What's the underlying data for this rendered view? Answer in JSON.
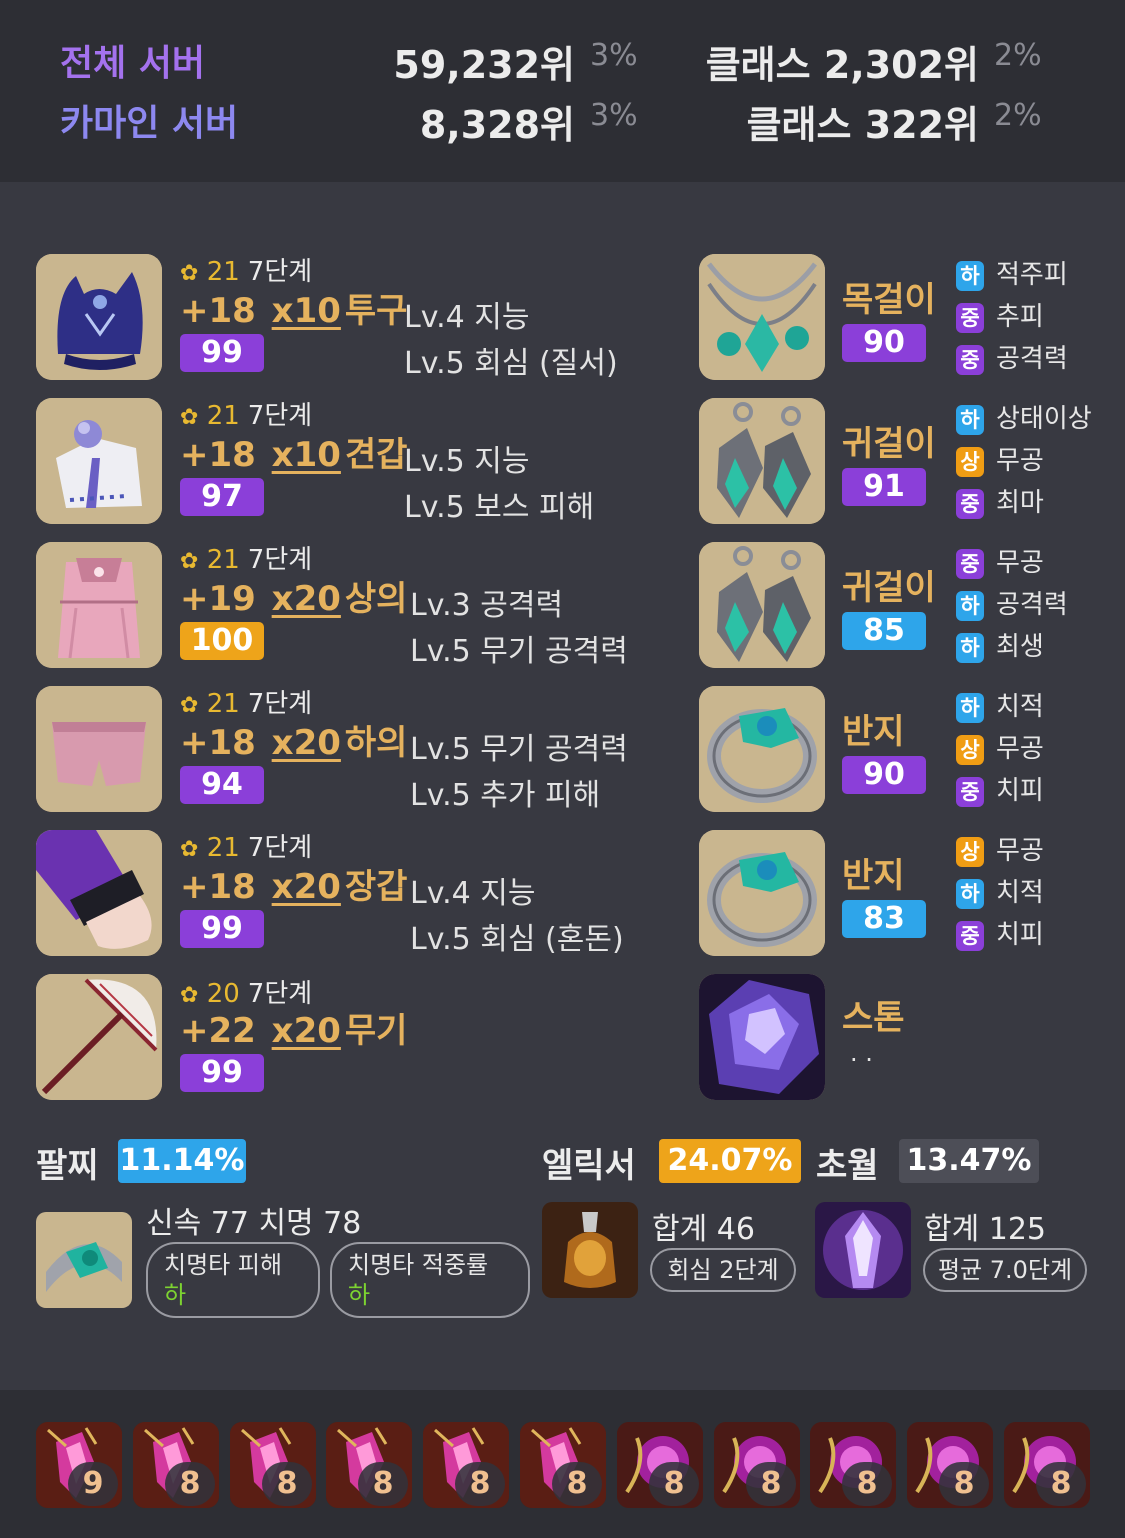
{
  "ranking": [
    {
      "name": "전체 서버",
      "color": "#a472ee",
      "rank": "59,232위",
      "rank_pct": "3%",
      "class_rank": "클래스 2,302위",
      "class_pct": "2%"
    },
    {
      "name": "카마인 서버",
      "color": "#8d88f0",
      "rank": "8,328위",
      "rank_pct": "3%",
      "class_rank": "클래스 322위",
      "class_pct": "2%"
    }
  ],
  "equipment": [
    {
      "icon": "helmet-icon",
      "tier": "21",
      "step": "7단계",
      "upgrade": "+18",
      "mult": "x10",
      "slot": "투구",
      "quality": "99",
      "quality_color": "purple",
      "engravings": [
        "Lv.4 지능",
        "Lv.5 회심 (질서)"
      ]
    },
    {
      "icon": "shoulder-icon",
      "tier": "21",
      "step": "7단계",
      "upgrade": "+18",
      "mult": "x10",
      "slot": "견갑",
      "quality": "97",
      "quality_color": "purple",
      "engravings": [
        "Lv.5 지능",
        "Lv.5 보스 피해"
      ]
    },
    {
      "icon": "chest-icon",
      "tier": "21",
      "step": "7단계",
      "upgrade": "+19",
      "mult": "x20",
      "slot": "상의",
      "quality": "100",
      "quality_color": "orange",
      "engravings": [
        "Lv.3 공격력",
        "Lv.5 무기 공격력"
      ]
    },
    {
      "icon": "pants-icon",
      "tier": "21",
      "step": "7단계",
      "upgrade": "+18",
      "mult": "x20",
      "slot": "하의",
      "quality": "94",
      "quality_color": "purple",
      "engravings": [
        "Lv.5 무기 공격력",
        "Lv.5 추가 피해"
      ]
    },
    {
      "icon": "gloves-icon",
      "tier": "21",
      "step": "7단계",
      "upgrade": "+18",
      "mult": "x20",
      "slot": "장갑",
      "quality": "99",
      "quality_color": "purple",
      "engravings": [
        "Lv.4 지능",
        "Lv.5 회심 (혼돈)"
      ]
    },
    {
      "icon": "weapon-umbrella-icon",
      "tier": "20",
      "step": "7단계",
      "upgrade": "+22",
      "mult": "x20",
      "slot": "무기",
      "quality": "99",
      "quality_color": "purple",
      "engravings": []
    }
  ],
  "accessories": [
    {
      "icon": "necklace-icon",
      "name": "목걸이",
      "quality": "90",
      "quality_color": "purple",
      "options": [
        {
          "grade": "하",
          "text": "적주피"
        },
        {
          "grade": "중",
          "text": "추피"
        },
        {
          "grade": "중",
          "text": "공격력"
        }
      ]
    },
    {
      "icon": "earring-icon",
      "name": "귀걸이",
      "quality": "91",
      "quality_color": "purple",
      "options": [
        {
          "grade": "하",
          "text": "상태이상"
        },
        {
          "grade": "상",
          "text": "무공"
        },
        {
          "grade": "중",
          "text": "최마"
        }
      ]
    },
    {
      "icon": "earring-icon",
      "name": "귀걸이",
      "quality": "85",
      "quality_color": "blue",
      "options": [
        {
          "grade": "중",
          "text": "무공"
        },
        {
          "grade": "하",
          "text": "공격력"
        },
        {
          "grade": "하",
          "text": "최생"
        }
      ]
    },
    {
      "icon": "ring-icon",
      "name": "반지",
      "quality": "90",
      "quality_color": "purple",
      "options": [
        {
          "grade": "하",
          "text": "치적"
        },
        {
          "grade": "상",
          "text": "무공"
        },
        {
          "grade": "중",
          "text": "치피"
        }
      ]
    },
    {
      "icon": "ring-icon",
      "name": "반지",
      "quality": "83",
      "quality_color": "blue",
      "options": [
        {
          "grade": "상",
          "text": "무공"
        },
        {
          "grade": "하",
          "text": "치적"
        },
        {
          "grade": "중",
          "text": "치피"
        }
      ]
    }
  ],
  "stone": {
    "icon": "ability-stone-icon",
    "name": "스톤",
    "value": "· ·"
  },
  "bracelet": {
    "label": "팔찌",
    "pct": "11.14%",
    "stats": "신속 77 치명 78",
    "tags": [
      {
        "name": "치명타 피해",
        "grade": "하"
      },
      {
        "name": "치명타 적중률",
        "grade": "하"
      }
    ]
  },
  "elixir": {
    "label": "엘릭서",
    "pct": "24.07%",
    "total": "합계 46",
    "tag": "회심 2단계"
  },
  "transcend": {
    "label": "초월",
    "pct": "13.47%",
    "total": "합계 125",
    "tag": "평균 7.0단계"
  },
  "gems": [
    {
      "type": "annihilation",
      "level": "9"
    },
    {
      "type": "annihilation",
      "level": "8"
    },
    {
      "type": "annihilation",
      "level": "8"
    },
    {
      "type": "annihilation",
      "level": "8"
    },
    {
      "type": "annihilation",
      "level": "8"
    },
    {
      "type": "annihilation",
      "level": "8"
    },
    {
      "type": "crimson",
      "level": "8"
    },
    {
      "type": "crimson",
      "level": "8"
    },
    {
      "type": "crimson",
      "level": "8"
    },
    {
      "type": "crimson",
      "level": "8"
    },
    {
      "type": "crimson",
      "level": "8"
    }
  ]
}
